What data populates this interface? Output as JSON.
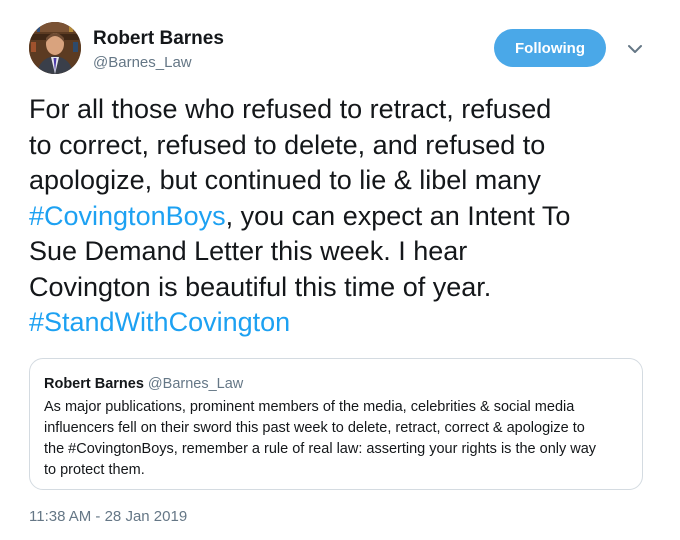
{
  "author": {
    "name": "Robert Barnes",
    "handle": "@Barnes_Law"
  },
  "follow_button": {
    "label": "Following",
    "color": "#4aa8e8"
  },
  "tweet": {
    "lines": [
      [
        {
          "text": "For all those who refused to retract, refused"
        }
      ],
      [
        {
          "text": "to correct, refused to delete, and refused to"
        }
      ],
      [
        {
          "text": "apologize, but continued to lie & libel many"
        }
      ],
      [
        {
          "text": "#CovingtonBoys",
          "hashtag": true
        },
        {
          "text": ", you can expect an Intent To"
        }
      ],
      [
        {
          "text": "Sue Demand Letter this week. I hear"
        }
      ],
      [
        {
          "text": "Covington is beautiful this time of year."
        }
      ],
      [
        {
          "text": "#StandWithCovington",
          "hashtag": true
        }
      ]
    ],
    "link_color": "#1da1f2"
  },
  "quoted_tweet": {
    "name": "Robert Barnes",
    "handle": "@Barnes_Law",
    "lines": [
      "As major publications, prominent members of the media, celebrities & social media",
      "influencers fell on their sword this past week to delete, retract, correct & apologize to",
      "the #CovingtonBoys, remember a rule of real law: asserting your rights is the only way",
      "to protect them."
    ]
  },
  "timestamp": "11:38 AM - 28 Jan 2019",
  "icons": {
    "avatar": "profile-photo",
    "caret": "chevron-down-icon"
  }
}
